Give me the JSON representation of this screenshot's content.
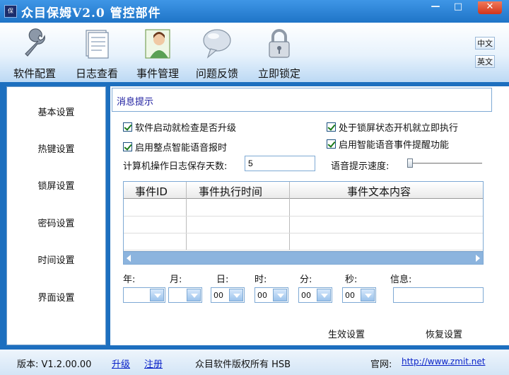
{
  "window": {
    "title": "众目保姆V2.0 管控部件",
    "icon_text": "保",
    "minimize": "—",
    "maximize": "□",
    "close": "✕"
  },
  "toolbar": {
    "items": [
      {
        "label": "软件配置",
        "icon": "wrench-icon"
      },
      {
        "label": "日志查看",
        "icon": "log-document-icon"
      },
      {
        "label": "事件管理",
        "icon": "person-card-icon"
      },
      {
        "label": "问题反馈",
        "icon": "speech-bubble-icon"
      },
      {
        "label": "立即锁定",
        "icon": "padlock-icon"
      }
    ],
    "lang_cn": "中文",
    "lang_en": "英文"
  },
  "sidebar": {
    "items": [
      {
        "label": "基本设置"
      },
      {
        "label": "热键设置"
      },
      {
        "label": "锁屏设置"
      },
      {
        "label": "密码设置"
      },
      {
        "label": "时间设置"
      },
      {
        "label": "界面设置"
      }
    ]
  },
  "panel": {
    "section_title": "消息提示",
    "options": {
      "check_upgrade": {
        "label": "软件启动就检查是否升级",
        "checked": true
      },
      "run_when_locked": {
        "label": "处于锁屏状态开机就立即执行",
        "checked": true
      },
      "hourly_voice": {
        "label": "启用整点智能语音报时",
        "checked": true
      },
      "voice_event_reminder": {
        "label": "启用智能语音事件提醒功能",
        "checked": true
      }
    },
    "log_days_label": "计算机操作日志保存天数:",
    "log_days_value": "5",
    "voice_speed_label": "语音提示速度:",
    "voice_speed_level": 0.05,
    "table": {
      "columns": [
        "事件ID",
        "事件执行时间",
        "事件文本内容"
      ],
      "rows": []
    },
    "date_fields": {
      "year": {
        "label": "年:",
        "value": ""
      },
      "month": {
        "label": "月:",
        "value": ""
      },
      "day": {
        "label": "日:",
        "value": "00"
      },
      "hour": {
        "label": "时:",
        "value": "00"
      },
      "minute": {
        "label": "分:",
        "value": "00"
      },
      "second": {
        "label": "秒:",
        "value": "00"
      },
      "info": {
        "label": "信息:",
        "value": ""
      }
    },
    "apply_label": "生效设置",
    "restore_label": "恢复设置"
  },
  "statusbar": {
    "version": "版本: V1.2.00.00",
    "upgrade": "升级",
    "register": "注册",
    "copyright": "众目软件版权所有 HSB",
    "website_label": "官网:",
    "website_url": "http://www.zmit.net"
  },
  "colors": {
    "frame_blue": "#1d6fbf",
    "title_gradient_top": "#3f96e6",
    "link_blue": "#0a22c8",
    "section_title": "#1a1a9e",
    "check_green": "#1a7a1a"
  }
}
